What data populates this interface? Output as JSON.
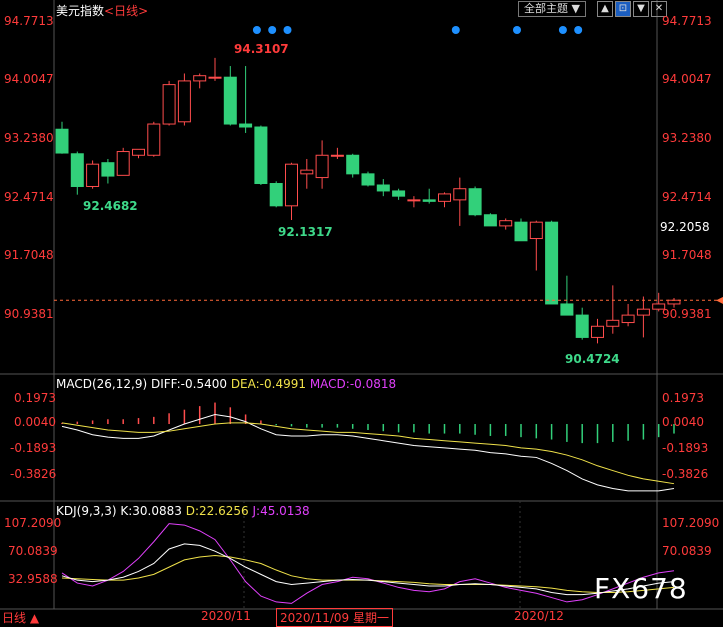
{
  "header": {
    "title": "美元指数",
    "period_label": "<日线>",
    "theme_button": "全部主题",
    "theme_arrow": "▼",
    "toolbar_up": "▲",
    "toolbar_sel": "⊡",
    "toolbar_down": "▼",
    "toolbar_close": "✕"
  },
  "price_axis": {
    "left": [
      "94.7713",
      "94.0047",
      "93.2380",
      "92.4714",
      "91.7048",
      "90.9381"
    ],
    "right": [
      "94.7713",
      "94.0047",
      "93.2380",
      "92.4714",
      "91.7048",
      "90.9381"
    ],
    "current_price": "92.2058"
  },
  "annotations": {
    "high": "94.3107",
    "low1": "92.4682",
    "low2": "92.1317",
    "low3": "90.4724"
  },
  "macd": {
    "label": "MACD(26,12,9)",
    "diff_text": "DIFF:-0.5400",
    "dea_text": "DEA:-0.4991",
    "macd_text": "MACD:-0.0818",
    "axis": [
      "0.1973",
      "0.0040",
      "-0.1893",
      "-0.3826"
    ]
  },
  "kdj": {
    "label": "KDJ(9,3,3)",
    "k_text": "K:30.0883",
    "d_text": "D:22.6256",
    "j_text": "J:45.0138",
    "axis_left": [
      "107.2090",
      "70.0839",
      "32.9588"
    ],
    "axis_right": [
      "107.2090",
      "70.0839"
    ]
  },
  "bottom_bar": {
    "period": "日线",
    "arrow": "▲",
    "tick1": "2020/11",
    "crosshair_date": "2020/11/09 星期一",
    "tick2": "2020/12"
  },
  "watermark": "FX678",
  "colors": {
    "up": "#ff4d4d",
    "down": "#32d07a",
    "text_red": "#ff3b3b",
    "dot_blue": "#1e90ff",
    "k_line": "#ffffff",
    "d_line": "#f0e24a",
    "j_line": "#e040fb"
  },
  "chart_data": {
    "type": "candlestick",
    "ylim": [
      90.3,
      94.9
    ],
    "candles": [
      {
        "o": 93.35,
        "h": 93.45,
        "l": 93.02,
        "c": 93.03
      },
      {
        "o": 93.02,
        "h": 93.05,
        "l": 92.47,
        "c": 92.58
      },
      {
        "o": 92.58,
        "h": 92.93,
        "l": 92.55,
        "c": 92.88
      },
      {
        "o": 92.9,
        "h": 92.95,
        "l": 92.62,
        "c": 92.72
      },
      {
        "o": 92.73,
        "h": 93.1,
        "l": 92.73,
        "c": 93.05
      },
      {
        "o": 93.0,
        "h": 93.08,
        "l": 92.96,
        "c": 93.08
      },
      {
        "o": 93.0,
        "h": 93.45,
        "l": 92.98,
        "c": 93.42
      },
      {
        "o": 93.42,
        "h": 94.0,
        "l": 93.4,
        "c": 93.95
      },
      {
        "o": 93.45,
        "h": 94.1,
        "l": 93.4,
        "c": 94.0
      },
      {
        "o": 94.0,
        "h": 94.1,
        "l": 93.9,
        "c": 94.07
      },
      {
        "o": 94.05,
        "h": 94.31,
        "l": 94.0,
        "c": 94.05
      },
      {
        "o": 94.05,
        "h": 94.2,
        "l": 93.4,
        "c": 93.42
      },
      {
        "o": 93.42,
        "h": 94.2,
        "l": 93.3,
        "c": 93.38
      },
      {
        "o": 93.38,
        "h": 93.4,
        "l": 92.6,
        "c": 92.62
      },
      {
        "o": 92.62,
        "h": 92.65,
        "l": 92.3,
        "c": 92.32
      },
      {
        "o": 92.32,
        "h": 92.9,
        "l": 92.13,
        "c": 92.88
      },
      {
        "o": 92.75,
        "h": 92.95,
        "l": 92.55,
        "c": 92.8
      },
      {
        "o": 92.7,
        "h": 93.2,
        "l": 92.55,
        "c": 93.0
      },
      {
        "o": 93.0,
        "h": 93.1,
        "l": 92.95,
        "c": 93.0
      },
      {
        "o": 93.0,
        "h": 93.02,
        "l": 92.7,
        "c": 92.75
      },
      {
        "o": 92.75,
        "h": 92.78,
        "l": 92.58,
        "c": 92.6
      },
      {
        "o": 92.6,
        "h": 92.68,
        "l": 92.45,
        "c": 92.52
      },
      {
        "o": 92.52,
        "h": 92.55,
        "l": 92.4,
        "c": 92.45
      },
      {
        "o": 92.4,
        "h": 92.45,
        "l": 92.3,
        "c": 92.4
      },
      {
        "o": 92.4,
        "h": 92.55,
        "l": 92.35,
        "c": 92.38
      },
      {
        "o": 92.38,
        "h": 92.5,
        "l": 92.3,
        "c": 92.48
      },
      {
        "o": 92.4,
        "h": 92.7,
        "l": 92.05,
        "c": 92.55
      },
      {
        "o": 92.55,
        "h": 92.58,
        "l": 92.18,
        "c": 92.2
      },
      {
        "o": 92.2,
        "h": 92.22,
        "l": 92.05,
        "c": 92.05
      },
      {
        "o": 92.05,
        "h": 92.15,
        "l": 92.0,
        "c": 92.12
      },
      {
        "o": 92.1,
        "h": 92.15,
        "l": 91.85,
        "c": 91.85
      },
      {
        "o": 91.88,
        "h": 92.12,
        "l": 91.45,
        "c": 92.1
      },
      {
        "o": 92.1,
        "h": 92.12,
        "l": 91.0,
        "c": 91.0
      },
      {
        "o": 91.0,
        "h": 91.38,
        "l": 90.85,
        "c": 90.85
      },
      {
        "o": 90.85,
        "h": 90.95,
        "l": 90.52,
        "c": 90.55
      },
      {
        "o": 90.55,
        "h": 90.8,
        "l": 90.47,
        "c": 90.7
      },
      {
        "o": 90.7,
        "h": 91.25,
        "l": 90.6,
        "c": 90.78
      },
      {
        "o": 90.75,
        "h": 91.0,
        "l": 90.7,
        "c": 90.85
      },
      {
        "o": 90.85,
        "h": 91.1,
        "l": 90.55,
        "c": 90.93
      },
      {
        "o": 90.93,
        "h": 91.15,
        "l": 90.9,
        "c": 91.0
      },
      {
        "o": 91.0,
        "h": 91.08,
        "l": 90.95,
        "c": 91.05
      }
    ],
    "markers": [
      13,
      14,
      15,
      26,
      30,
      33,
      34
    ],
    "current_price": 91.05,
    "macd": {
      "ylim": [
        -0.62,
        0.26
      ],
      "hist": [
        0.01,
        0.02,
        0.03,
        0.04,
        0.04,
        0.05,
        0.06,
        0.09,
        0.12,
        0.15,
        0.18,
        0.14,
        0.08,
        0.03,
        -0.01,
        -0.02,
        -0.03,
        -0.03,
        -0.03,
        -0.04,
        -0.05,
        -0.06,
        -0.07,
        -0.07,
        -0.08,
        -0.08,
        -0.08,
        -0.09,
        -0.1,
        -0.1,
        -0.11,
        -0.12,
        -0.13,
        -0.15,
        -0.16,
        -0.16,
        -0.15,
        -0.14,
        -0.13,
        -0.11,
        -0.08
      ],
      "diff": [
        -0.02,
        -0.05,
        -0.09,
        -0.11,
        -0.12,
        -0.12,
        -0.1,
        -0.05,
        0.0,
        0.04,
        0.08,
        0.06,
        0.02,
        -0.04,
        -0.09,
        -0.1,
        -0.1,
        -0.09,
        -0.09,
        -0.1,
        -0.12,
        -0.14,
        -0.16,
        -0.18,
        -0.19,
        -0.2,
        -0.21,
        -0.22,
        -0.24,
        -0.25,
        -0.27,
        -0.28,
        -0.33,
        -0.39,
        -0.46,
        -0.51,
        -0.54,
        -0.56,
        -0.56,
        -0.56,
        -0.54
      ],
      "dea": [
        0.01,
        -0.01,
        -0.03,
        -0.05,
        -0.06,
        -0.07,
        -0.07,
        -0.06,
        -0.04,
        -0.02,
        0.0,
        0.01,
        0.01,
        0.0,
        -0.02,
        -0.04,
        -0.05,
        -0.06,
        -0.07,
        -0.07,
        -0.08,
        -0.09,
        -0.1,
        -0.12,
        -0.13,
        -0.14,
        -0.15,
        -0.16,
        -0.17,
        -0.18,
        -0.2,
        -0.21,
        -0.23,
        -0.26,
        -0.3,
        -0.35,
        -0.39,
        -0.43,
        -0.46,
        -0.48,
        -0.5
      ]
    },
    "kdj": {
      "ylim": [
        -5,
        115
      ],
      "k": [
        38,
        32,
        30,
        32,
        36,
        44,
        55,
        75,
        82,
        80,
        72,
        62,
        50,
        40,
        30,
        26,
        28,
        30,
        32,
        33,
        32,
        30,
        28,
        26,
        24,
        24,
        26,
        27,
        26,
        24,
        22,
        20,
        15,
        12,
        12,
        14,
        17,
        20,
        24,
        28,
        30
      ],
      "d": [
        35,
        34,
        33,
        32,
        32,
        35,
        40,
        50,
        60,
        64,
        66,
        64,
        60,
        55,
        46,
        38,
        34,
        32,
        32,
        32,
        32,
        31,
        30,
        29,
        27,
        26,
        26,
        26,
        26,
        25,
        24,
        23,
        21,
        18,
        16,
        15,
        15,
        16,
        18,
        20,
        22
      ],
      "j": [
        42,
        28,
        24,
        32,
        44,
        62,
        85,
        110,
        108,
        100,
        88,
        60,
        30,
        10,
        2,
        0,
        14,
        26,
        30,
        36,
        34,
        28,
        22,
        18,
        16,
        20,
        30,
        34,
        28,
        22,
        18,
        14,
        8,
        2,
        5,
        12,
        20,
        28,
        36,
        42,
        45
      ]
    }
  }
}
